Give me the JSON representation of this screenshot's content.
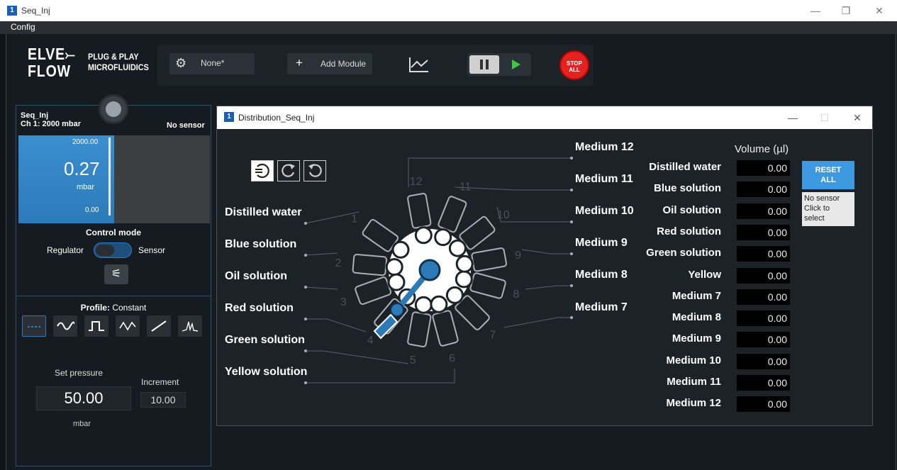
{
  "window": {
    "title": "Seq_Inj",
    "app_icon": "1",
    "minimize": "—",
    "restore": "❐",
    "close": "✕"
  },
  "menu": {
    "config": "Config"
  },
  "logo": {
    "line1": "ELVE",
    "line1b": "FLOW",
    "tag1": "PLUG & PLAY",
    "tag2": "MICROFLUIDICS"
  },
  "toolbar": {
    "config_value": "None*",
    "add_module_icon": "+",
    "add_module_label": "Add Module",
    "stop_line1": "STOP",
    "stop_line2": "ALL"
  },
  "left_panel": {
    "name": "Seq_Inj",
    "channel": "Ch 1: 2000 mbar",
    "sensor": "No sensor",
    "gauge_max": "2000.00",
    "gauge_min": "0.00",
    "value": "0.27",
    "unit": "mbar",
    "control_mode_label": "Control mode",
    "regulator_label": "Regulator",
    "sensor_label": "Sensor",
    "profile_label": "Profile:",
    "profile_value": " Constant",
    "set_pressure_label": "Set pressure",
    "increment_label": "Increment",
    "set_pressure": "50.00",
    "increment": "10.00",
    "pressure_unit": "mbar"
  },
  "dialog": {
    "title": "Distribution_Seq_Inj",
    "app_icon": "1",
    "minimize": "—",
    "maximize": "☐",
    "close": "✕",
    "inputs": [
      "Distilled water",
      "Blue solution",
      "Oil solution",
      "Red solution",
      "Green solution",
      "Yellow solution"
    ],
    "mediums": [
      "Medium 12",
      "Medium 11",
      "Medium 10",
      "Medium 9",
      "Medium 8",
      "Medium 7"
    ],
    "port_numbers": [
      "1",
      "2",
      "3",
      "4",
      "5",
      "6",
      "7",
      "8",
      "9",
      "10",
      "11",
      "12"
    ],
    "volume_header": "Volume (µl)",
    "volumes": [
      {
        "label": "Distilled water",
        "value": "0.00"
      },
      {
        "label": "Blue solution",
        "value": "0.00"
      },
      {
        "label": "Oil solution",
        "value": "0.00"
      },
      {
        "label": "Red solution",
        "value": "0.00"
      },
      {
        "label": "Green solution",
        "value": "0.00"
      },
      {
        "label": "Yellow",
        "value": "0.00"
      },
      {
        "label": "Medium 7",
        "value": "0.00"
      },
      {
        "label": "Medium 8",
        "value": "0.00"
      },
      {
        "label": "Medium 9",
        "value": "0.00"
      },
      {
        "label": "Medium 10",
        "value": "0.00"
      },
      {
        "label": "Medium 11",
        "value": "0.00"
      },
      {
        "label": "Medium 12",
        "value": "0.00"
      }
    ],
    "reset_line1": "RESET",
    "reset_line2": "ALL",
    "sensor_line1": "No sensor",
    "sensor_line2": "Click to",
    "sensor_line3": "select"
  },
  "colors": {
    "accent": "#2d7ab8",
    "stop": "#e32222",
    "play": "#3ec93e",
    "reset": "#3d9ae0"
  },
  "icons": [
    "gear-icon",
    "plus-icon",
    "chart-icon",
    "pause-icon",
    "play-icon",
    "tune-icon",
    "rotate-shortest-icon",
    "rotate-clockwise-icon",
    "rotate-counterclockwise-icon"
  ]
}
